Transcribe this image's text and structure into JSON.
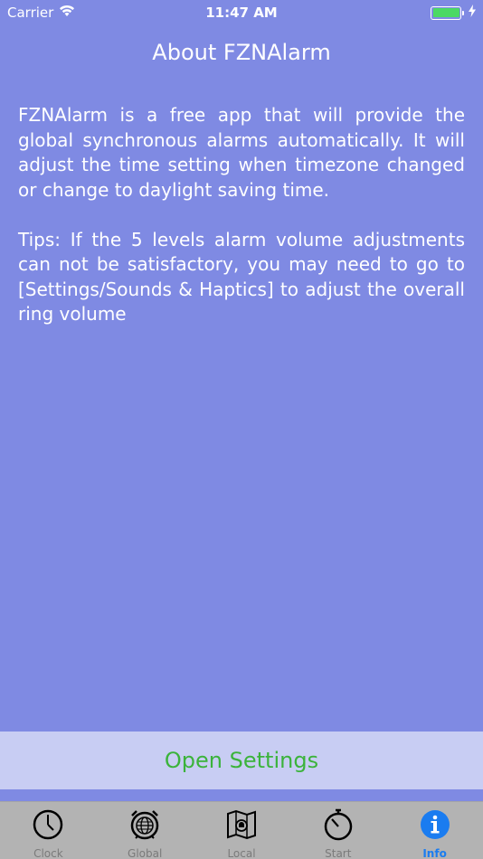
{
  "status_bar": {
    "carrier": "Carrier",
    "time": "11:47 AM",
    "battery_color": "#4cd964"
  },
  "page": {
    "title": "About FZNAlarm",
    "paragraphs": [
      "FZNAlarm is a free app that will provide the global synchronous alarms automatically. It will adjust the time setting when timezone changed or change to daylight saving time.",
      "Tips: If the 5 levels alarm volume adjustments can not be satisfactory, you may need to  go to [Settings/Sounds & Haptics] to adjust the overall ring volume"
    ]
  },
  "settings_button": {
    "label": "Open Settings",
    "color": "#3bb33b"
  },
  "tabs": [
    {
      "label": "Clock",
      "icon": "clock-icon"
    },
    {
      "label": "Global",
      "icon": "globe-alarm-icon"
    },
    {
      "label": "Local",
      "icon": "map-alarm-icon"
    },
    {
      "label": "Start",
      "icon": "stopwatch-icon"
    },
    {
      "label": "Info",
      "icon": "info-icon",
      "active": true
    }
  ],
  "colors": {
    "background": "#7f8ae3",
    "tab_active": "#1a7cf0",
    "tab_inactive": "#7a7a7a"
  }
}
